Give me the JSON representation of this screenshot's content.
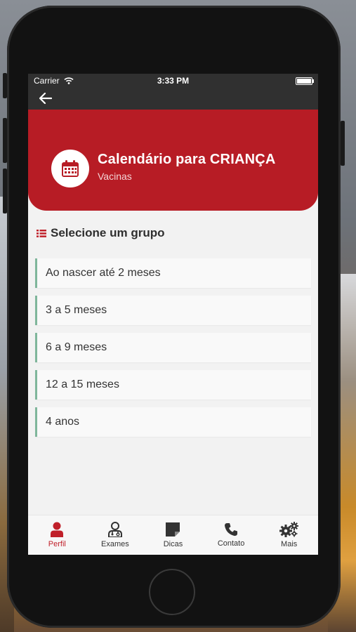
{
  "status_bar": {
    "carrier": "Carrier",
    "time": "3:33 PM"
  },
  "header": {
    "title": "Calendário para CRIANÇA",
    "subtitle": "Vacinas"
  },
  "section": {
    "label": "Selecione um grupo"
  },
  "groups": [
    {
      "label": "Ao nascer até 2 meses"
    },
    {
      "label": "3 a 5 meses"
    },
    {
      "label": "6 a 9 meses"
    },
    {
      "label": "12 a 15 meses"
    },
    {
      "label": "4 anos"
    }
  ],
  "tabs": [
    {
      "label": "Perfil",
      "icon": "person-icon",
      "active": true
    },
    {
      "label": "Exames",
      "icon": "doctor-icon",
      "active": false
    },
    {
      "label": "Dicas",
      "icon": "note-icon",
      "active": false
    },
    {
      "label": "Contato",
      "icon": "phone-icon",
      "active": false
    },
    {
      "label": "Mais",
      "icon": "gears-icon",
      "active": false
    }
  ],
  "colors": {
    "accent": "#b71c25",
    "bar": "#303030",
    "list_border": "#7fb69b"
  }
}
